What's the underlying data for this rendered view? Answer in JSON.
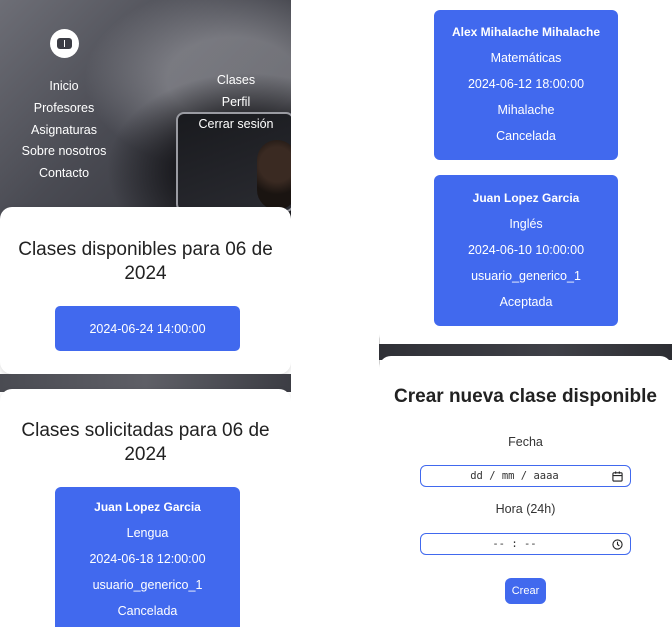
{
  "nav": {
    "left_links": [
      "Inicio",
      "Profesores",
      "Asignaturas",
      "Sobre nosotros",
      "Contacto"
    ],
    "right_links": [
      "Clases",
      "Perfil",
      "Cerrar sesión"
    ]
  },
  "available": {
    "title": "Clases disponibles para 06 de 2024",
    "slots": [
      "2024-06-24 14:00:00"
    ]
  },
  "requested": {
    "title": "Clases solicitadas para 06 de 2024",
    "classes": [
      {
        "teacher": "Juan Lopez Garcia",
        "subject": "Lengua",
        "datetime": "2024-06-18 12:00:00",
        "student": "usuario_generico_1",
        "status": "Cancelada"
      }
    ]
  },
  "class_list": [
    {
      "teacher": "Alex Mihalache Mihalache",
      "subject": "Matemáticas",
      "datetime": "2024-06-12 18:00:00",
      "student": "Mihalache",
      "status": "Cancelada"
    },
    {
      "teacher": "Juan Lopez Garcia",
      "subject": "Inglés",
      "datetime": "2024-06-10 10:00:00",
      "student": "usuario_generico_1",
      "status": "Aceptada"
    }
  ],
  "create_form": {
    "title": "Crear nueva clase disponible",
    "date_label": "Fecha",
    "date_placeholder": "dd / mm / aaaa",
    "time_label": "Hora (24h)",
    "time_placeholder": "-- : --",
    "submit_label": "Crear"
  },
  "colors": {
    "accent": "#4169ee"
  }
}
